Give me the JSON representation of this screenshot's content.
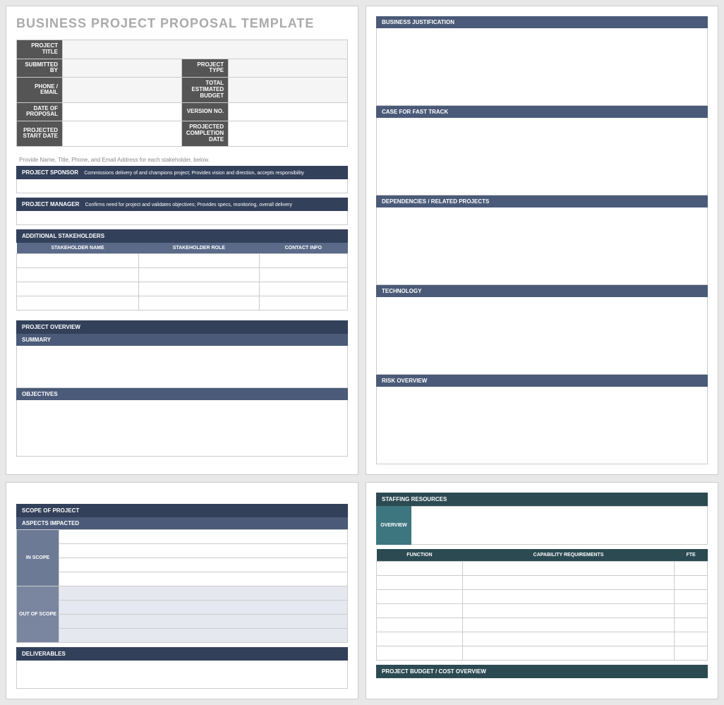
{
  "title": "BUSINESS PROJECT PROPOSAL TEMPLATE",
  "meta": {
    "projectTitle": "PROJECT TITLE",
    "submittedBy": "SUBMITTED BY",
    "projectType": "PROJECT TYPE",
    "phoneEmail": "PHONE / EMAIL",
    "totalBudget": "TOTAL ESTIMATED BUDGET",
    "dateOfProposal": "DATE OF PROPOSAL",
    "versionNo": "VERSION NO.",
    "projectedStart": "PROJECTED START DATE",
    "projectedCompletion": "PROJECTED COMPLETION DATE"
  },
  "note": "Provide Name, Title, Phone, and Email Address for each stakeholder, below.",
  "sponsor": {
    "label": "PROJECT SPONSOR",
    "desc": "Commissions delivery of and champions project; Provides vision and direction, accepts responsibility"
  },
  "manager": {
    "label": "PROJECT MANAGER",
    "desc": "Confirms need for project and validates objectives; Provides specs, monitoring, overall delivery"
  },
  "stakeholders": {
    "title": "ADDITIONAL STAKEHOLDERS",
    "cols": {
      "name": "STAKEHOLDER NAME",
      "role": "STAKEHOLDER ROLE",
      "contact": "CONTACT INFO"
    }
  },
  "overview": {
    "title": "PROJECT OVERVIEW",
    "summary": "SUMMARY",
    "objectives": "OBJECTIVES"
  },
  "p2": {
    "justification": "BUSINESS JUSTIFICATION",
    "fastTrack": "CASE FOR FAST TRACK",
    "dependencies": "DEPENDENCIES / RELATED PROJECTS",
    "technology": "TECHNOLOGY",
    "risk": "RISK OVERVIEW"
  },
  "scope": {
    "title": "SCOPE OF PROJECT",
    "aspects": "ASPECTS IMPACTED",
    "inScope": "IN SCOPE",
    "outScope": "OUT OF SCOPE",
    "deliverables": "DELIVERABLES"
  },
  "staffing": {
    "title": "STAFFING RESOURCES",
    "overview": "OVERVIEW",
    "cols": {
      "fn": "FUNCTION",
      "cap": "CAPABILITY REQUIREMENTS",
      "fte": "FTE"
    },
    "budget": "PROJECT BUDGET / COST OVERVIEW"
  }
}
